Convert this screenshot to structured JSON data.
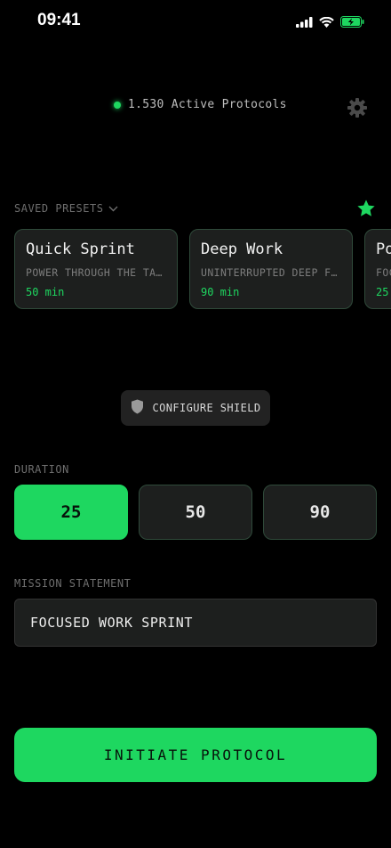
{
  "status_bar": {
    "time": "09:41"
  },
  "header": {
    "active_count_text": "1.530 Active Protocols"
  },
  "presets": {
    "label": "SAVED PRESETS",
    "items": [
      {
        "title": "Quick Sprint",
        "description": "POWER THROUGH THE TASKS",
        "duration": "50 min"
      },
      {
        "title": "Deep Work",
        "description": "UNINTERRUPTED DEEP FOCUS",
        "duration": "90 min"
      },
      {
        "title": "Po",
        "description": "FOC",
        "duration": "25"
      }
    ]
  },
  "shield": {
    "label": "CONFIGURE SHIELD"
  },
  "duration": {
    "label": "DURATION",
    "options": [
      "25",
      "50",
      "90"
    ],
    "selected": "25"
  },
  "mission": {
    "label": "MISSION STATEMENT",
    "value": "FOCUSED WORK SPRINT"
  },
  "initiate": {
    "label": "INITIATE PROTOCOL"
  },
  "colors": {
    "accent": "#1ed760",
    "background": "#000000",
    "card": "#1d1f1e"
  },
  "icons": [
    "signal-icon",
    "wifi-icon",
    "battery-icon",
    "gear-icon",
    "chevron-down-icon",
    "star-icon",
    "shield-icon"
  ]
}
